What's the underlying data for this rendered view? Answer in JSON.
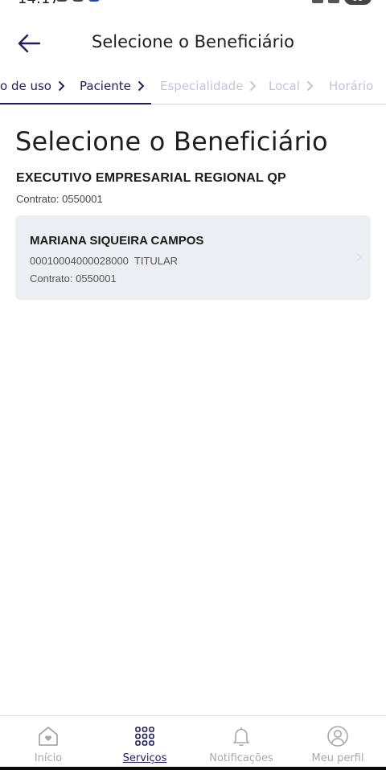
{
  "status_bar": {
    "time": "14:17",
    "battery": "69"
  },
  "header": {
    "title": "Selecione o Beneficiário"
  },
  "stepper": {
    "steps": [
      {
        "label": "o de uso",
        "state": "done"
      },
      {
        "label": "Paciente",
        "state": "active"
      },
      {
        "label": "Especialidade",
        "state": "pending"
      },
      {
        "label": "Local",
        "state": "pending"
      },
      {
        "label": "Horário",
        "state": "pending"
      }
    ]
  },
  "content": {
    "page_title": "Selecione o Beneficiário",
    "company_name": "EXECUTIVO EMPRESARIAL REGIONAL QP",
    "company_contract": "Contrato: 0550001",
    "beneficiaries": [
      {
        "name": "MARIANA SIQUEIRA CAMPOS",
        "id_line": "00010004000028000  TITULAR",
        "contract": "Contrato: 0550001"
      }
    ]
  },
  "bottom_nav": {
    "items": [
      {
        "label": "Início",
        "icon": "home-heart-icon"
      },
      {
        "label": "Serviços",
        "icon": "grid-icon",
        "selected": true
      },
      {
        "label": "Notificações",
        "icon": "bell-icon"
      },
      {
        "label": "Meu perfil",
        "icon": "user-circle-icon"
      }
    ]
  },
  "colors": {
    "primary": "#1e1f5e",
    "pending_step": "#c6c3d8",
    "card_bg": "#eceef4",
    "nav_inactive": "#a7a7b0"
  }
}
